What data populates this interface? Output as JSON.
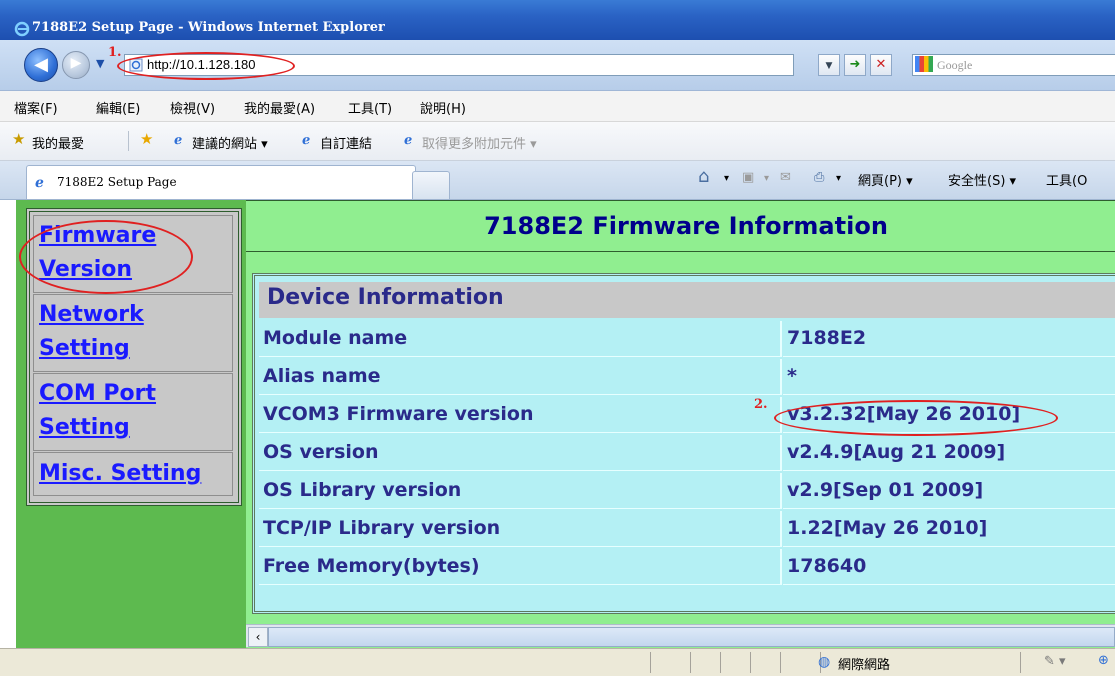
{
  "window": {
    "title": "7188E2 Setup Page - Windows Internet Explorer"
  },
  "address": {
    "url": "http://10.1.128.180"
  },
  "search": {
    "placeholder": "Google"
  },
  "menu": [
    "檔案(F)",
    "編輯(E)",
    "檢視(V)",
    "我的最愛(A)",
    "工具(T)",
    "說明(H)"
  ],
  "favorites_bar": {
    "favorites": "我的最愛",
    "suggested": "建議的網站 ▾",
    "custom": "自訂連結",
    "addons": "取得更多附加元件 ▾"
  },
  "tab": {
    "label": "7188E2 Setup Page"
  },
  "commands": {
    "page": "網頁(P) ▾",
    "safety": "安全性(S) ▾",
    "tools": "工具(O"
  },
  "nav": {
    "items": [
      {
        "line1": "Firmware",
        "line2": "Version"
      },
      {
        "line1": "Network",
        "line2": "Setting"
      },
      {
        "line1": "COM Port",
        "line2": "Setting"
      },
      {
        "line1": "Misc. Setting",
        "line2": ""
      }
    ]
  },
  "page": {
    "title": "7188E2 Firmware Information",
    "section": "Device Information",
    "rows": [
      {
        "label": "Module name",
        "value": "7188E2"
      },
      {
        "label": "Alias name",
        "value": "*"
      },
      {
        "label": "VCOM3 Firmware version",
        "value": "v3.2.32[May 26 2010]"
      },
      {
        "label": "OS version",
        "value": "v2.4.9[Aug 21 2009]"
      },
      {
        "label": "OS Library version",
        "value": "v2.9[Sep 01 2009]"
      },
      {
        "label": "TCP/IP Library version",
        "value": "1.22[May 26 2010]"
      },
      {
        "label": "Free Memory(bytes)",
        "value": "178640"
      }
    ]
  },
  "status": {
    "zone": "網際網路"
  },
  "annotations": {
    "one": "1.",
    "two": "2."
  },
  "colors": {
    "annotation": "#e02020",
    "nav_link": "#1a1aff",
    "content_bg": "#90ee90",
    "table_bg": "#b4f0f4"
  }
}
